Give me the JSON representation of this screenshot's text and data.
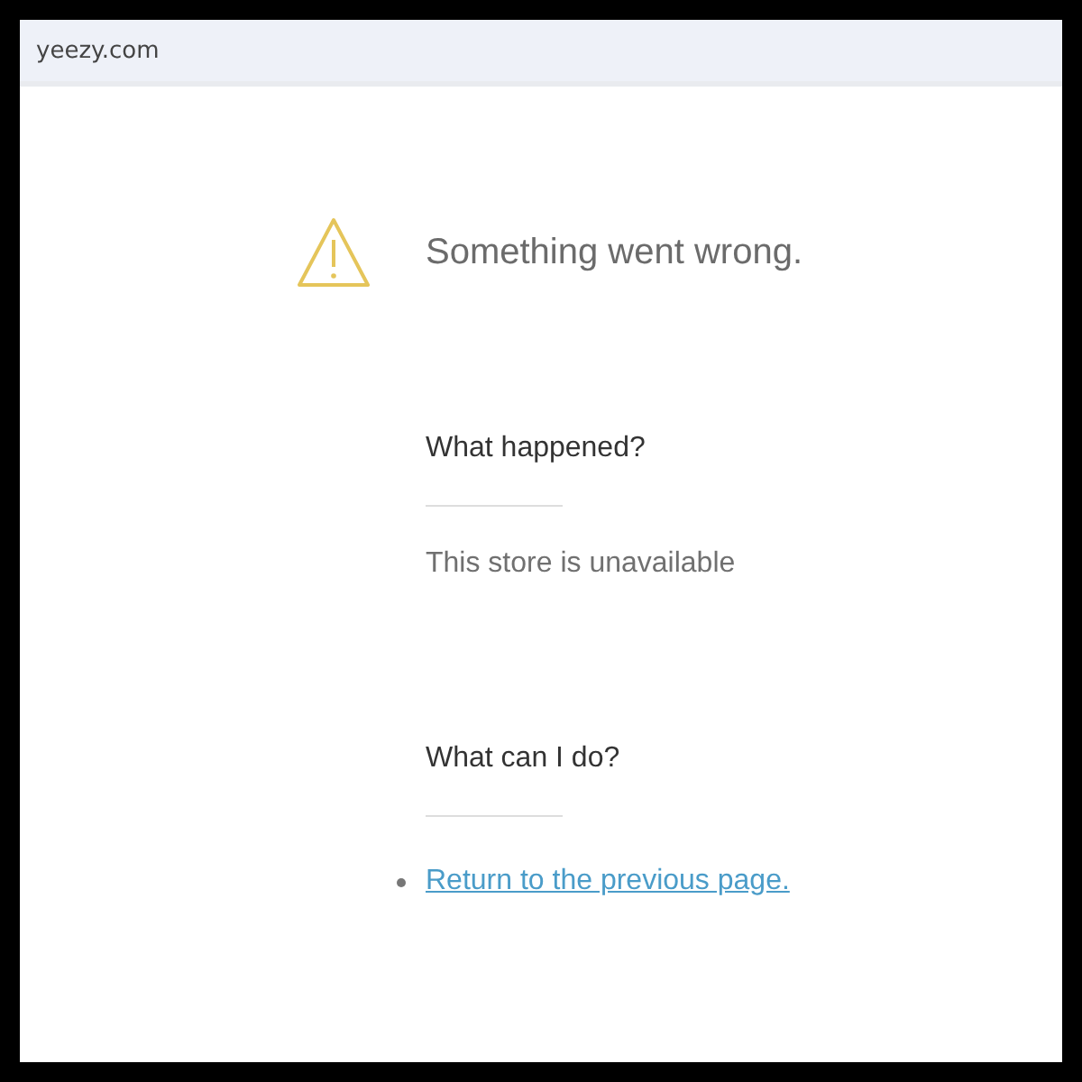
{
  "address_bar": {
    "url": "yeezy.com"
  },
  "error": {
    "title": "Something went wrong.",
    "sections": [
      {
        "heading": "What happened?",
        "kind": "text",
        "text": "This store is unavailable"
      },
      {
        "heading": "What can I do?",
        "kind": "links",
        "links": [
          "Return to the previous page."
        ]
      }
    ]
  }
}
